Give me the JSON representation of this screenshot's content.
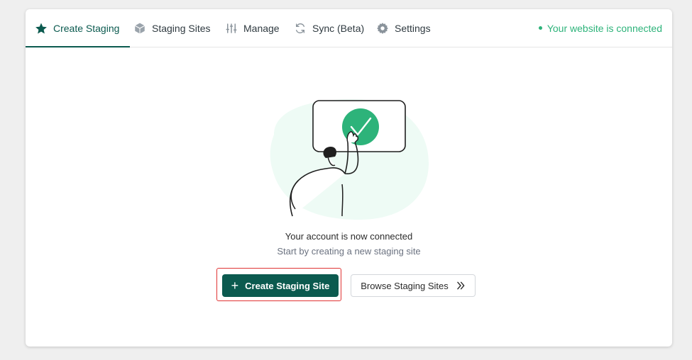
{
  "tabs": [
    {
      "label": "Create Staging",
      "icon": "star-icon",
      "active": true
    },
    {
      "label": "Staging Sites",
      "icon": "cube-icon",
      "active": false
    },
    {
      "label": "Manage",
      "icon": "sliders-icon",
      "active": false
    },
    {
      "label": "Sync (Beta)",
      "icon": "sync-icon",
      "active": false
    },
    {
      "label": "Settings",
      "icon": "gear-icon",
      "active": false
    }
  ],
  "status": {
    "text": "Your website is connected",
    "color": "#2db37a"
  },
  "main": {
    "headline": "Your account is now connected",
    "subline": "Start by creating a new staging site",
    "primary_button": {
      "label": "Create Staging Site",
      "icon": "plus-icon"
    },
    "secondary_button": {
      "label": "Browse Staging Sites",
      "icon": "double-chevron-right-icon"
    }
  },
  "colors": {
    "brand": "#0b5a4f",
    "accent_green": "#2db37a",
    "highlight_border": "#e03434",
    "illustration_bg": "#eefbf5"
  }
}
